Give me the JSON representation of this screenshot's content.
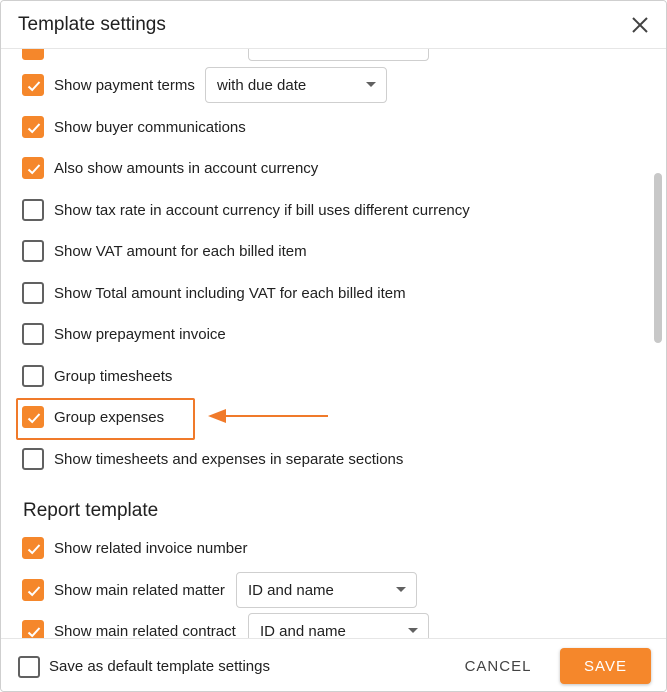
{
  "header": {
    "title": "Template settings",
    "close_icon": "close-icon"
  },
  "payment_terms": {
    "label": "Show payment terms",
    "checked": true,
    "select_value": "with due date"
  },
  "options": [
    {
      "label": "Show buyer communications",
      "checked": true
    },
    {
      "label": "Also show amounts in account currency",
      "checked": true
    },
    {
      "label": "Show tax rate in account currency if bill uses different currency",
      "checked": false
    },
    {
      "label": "Show VAT amount for each billed item",
      "checked": false
    },
    {
      "label": "Show Total amount including VAT for each billed item",
      "checked": false
    },
    {
      "label": "Show prepayment invoice",
      "checked": false
    },
    {
      "label": "Group timesheets",
      "checked": false
    },
    {
      "label": "Group expenses",
      "checked": true
    },
    {
      "label": "Show timesheets and expenses in separate sections",
      "checked": false
    }
  ],
  "report_template": {
    "title": "Report template",
    "invoice_number": {
      "label": "Show related invoice number",
      "checked": true
    },
    "main_matter": {
      "label": "Show main related matter",
      "checked": true,
      "select_value": "ID and name"
    },
    "main_contract": {
      "label": "Show main related contract",
      "checked": true,
      "select_value": "ID and name"
    }
  },
  "footer": {
    "default_label": "Save as default template settings",
    "default_checked": false,
    "cancel_label": "CANCEL",
    "save_label": "SAVE"
  },
  "colors": {
    "accent": "#f5872b",
    "annotation": "#f07a2a"
  }
}
